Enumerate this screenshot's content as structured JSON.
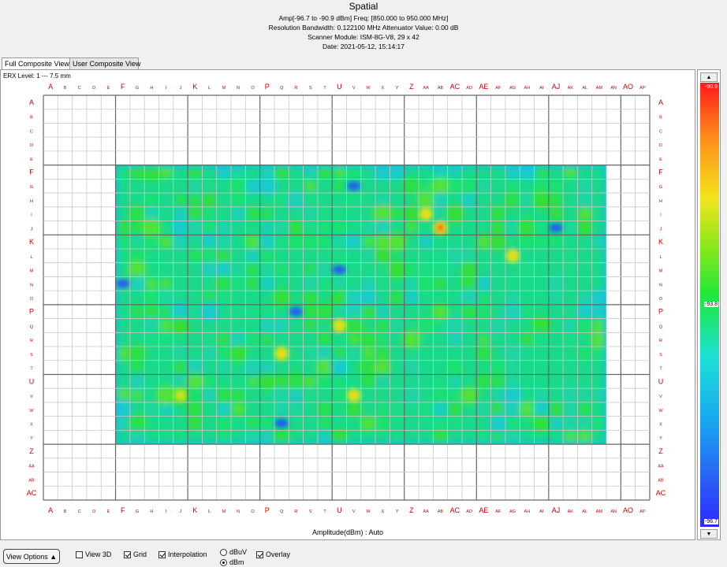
{
  "header": {
    "title": "Spatial",
    "line1": "Amp[-96.7 to -90.9 dBm]  Freq: [850.000  to 950.000  MHz]",
    "line2": "Resolution Bandwidth: 0.122100 MHz     Attenuator Value:   0.00 dB",
    "line3": "Scanner Module: ISM-8G-V8,  29 x 42",
    "line4": "Date: 2021-05-12,  15:14:17"
  },
  "tabs": [
    {
      "label": "Full Composite View",
      "active": true
    },
    {
      "label": "User Composite View",
      "active": false
    }
  ],
  "erx_label": "ERX Level: 1 --- 7.5 mm",
  "grid": {
    "columns": [
      "A",
      "B",
      "C",
      "D",
      "E",
      "F",
      "G",
      "H",
      "I",
      "J",
      "K",
      "L",
      "M",
      "N",
      "O",
      "P",
      "Q",
      "R",
      "S",
      "T",
      "U",
      "V",
      "W",
      "X",
      "Y",
      "Z",
      "AA",
      "AB",
      "AC",
      "AD",
      "AE",
      "AF",
      "AG",
      "AH",
      "AI",
      "AJ",
      "AK",
      "AL",
      "AM",
      "AN",
      "AO",
      "AP"
    ],
    "rows": [
      "A",
      "B",
      "C",
      "D",
      "E",
      "F",
      "G",
      "H",
      "I",
      "J",
      "K",
      "L",
      "M",
      "N",
      "O",
      "P",
      "Q",
      "R",
      "S",
      "T",
      "U",
      "V",
      "W",
      "X",
      "Y",
      "Z",
      "AA",
      "AB",
      "AC"
    ],
    "major_labels": [
      "A",
      "F",
      "K",
      "P",
      "U",
      "Z",
      "AE",
      "AJ",
      "AO",
      "AC"
    ],
    "label_color": "#cc0000"
  },
  "heatmap": {
    "col_range": [
      "F",
      "AM"
    ],
    "row_range": [
      "F",
      "Y"
    ],
    "hotspots": [
      {
        "col": "AB",
        "row": "J",
        "level": "red"
      },
      {
        "col": "AG",
        "row": "L",
        "level": "yellow"
      },
      {
        "col": "AA",
        "row": "I",
        "level": "yellow"
      },
      {
        "col": "U",
        "row": "Q",
        "level": "yellow"
      },
      {
        "col": "Q",
        "row": "S",
        "level": "yellow"
      },
      {
        "col": "V",
        "row": "V",
        "level": "yellow"
      },
      {
        "col": "J",
        "row": "V",
        "level": "yellow-green"
      }
    ],
    "coldspots": [
      {
        "col": "F",
        "row": "N"
      },
      {
        "col": "AJ",
        "row": "J"
      },
      {
        "col": "V",
        "row": "G"
      },
      {
        "col": "U",
        "row": "M"
      },
      {
        "col": "R",
        "row": "P"
      },
      {
        "col": "Q",
        "row": "X"
      }
    ]
  },
  "x_axis_title": "Amplitude(dBm) : Auto",
  "scale": {
    "max": "-90.9",
    "mid": "-93.8",
    "min": "-96.7",
    "max_color": "#ff1a1a",
    "min_color": "#2a2aff"
  },
  "controls": {
    "view_options": "View Options",
    "view3d": {
      "label": "View 3D",
      "checked": false
    },
    "grid": {
      "label": "Grid",
      "checked": true
    },
    "interpolation": {
      "label": "Interpolation",
      "checked": true
    },
    "dbuv": {
      "label": "dBuV",
      "selected": false
    },
    "dbm": {
      "label": "dBm",
      "selected": true
    },
    "overlay": {
      "label": "Overlay",
      "checked": true
    }
  }
}
